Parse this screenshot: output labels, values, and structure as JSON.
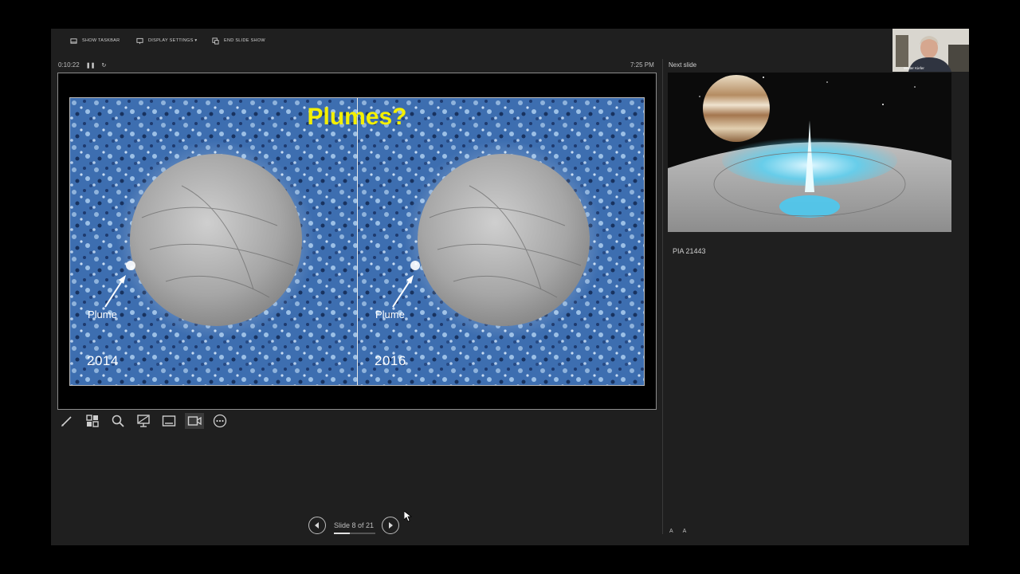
{
  "topbar": {
    "show_taskbar": "SHOW TASKBAR",
    "display_settings": "DISPLAY SETTINGS ▾",
    "end_slide_show": "END SLIDE SHOW"
  },
  "webcam": {
    "name": "Walter Kiefer"
  },
  "presenter": {
    "elapsed": "0:10:22",
    "clock": "7:25 PM"
  },
  "slide": {
    "title": "Plumes?",
    "panels": [
      {
        "plume_label": "Plume",
        "year": "2014"
      },
      {
        "plume_label": "Plume",
        "year": "2016"
      }
    ]
  },
  "toolbar": {
    "icons": [
      "pen-icon",
      "all-slides-icon",
      "zoom-icon",
      "black-screen-icon",
      "subtitles-icon",
      "camera-icon",
      "more-options-icon"
    ]
  },
  "navigation": {
    "slide_counter": "Slide 8 of 21",
    "progress": 0.38
  },
  "next": {
    "label": "Next slide",
    "notes": "PIA 21443"
  },
  "font_controls": {
    "increase": "A",
    "decrease": "A"
  },
  "colors": {
    "title": "#f4f000",
    "background": "#1f1f1f",
    "plume_blue": "#3a6fb3"
  }
}
